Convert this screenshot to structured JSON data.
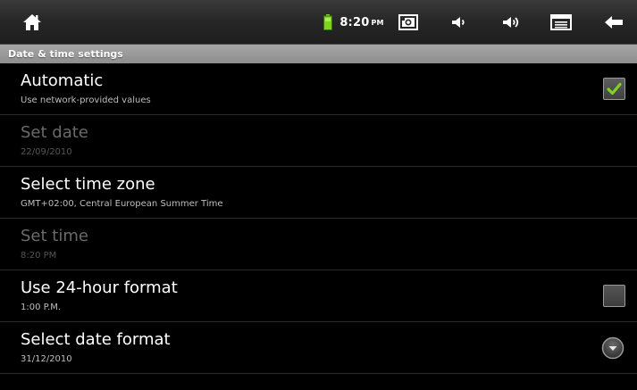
{
  "status_bar": {
    "time": "8:20",
    "ampm": "PM",
    "icons": [
      "home-icon",
      "battery-icon",
      "screenshot-icon",
      "volume-down-icon",
      "volume-up-icon",
      "menu-icon",
      "back-icon"
    ]
  },
  "title": "Date & time settings",
  "settings": [
    {
      "label": "Automatic",
      "summary": "Use network-provided values",
      "enabled": true,
      "widget": "checkbox",
      "checked": true
    },
    {
      "label": "Set date",
      "summary": "22/09/2010",
      "enabled": false
    },
    {
      "label": "Select time zone",
      "summary": "GMT+02:00, Central European Summer Time",
      "enabled": true
    },
    {
      "label": "Set time",
      "summary": "8:20 PM",
      "enabled": false
    },
    {
      "label": "Use 24-hour format",
      "summary": "1:00 P.M.",
      "enabled": true,
      "widget": "checkbox",
      "checked": false
    },
    {
      "label": "Select date format",
      "summary": "31/12/2010",
      "enabled": true,
      "widget": "dropdown"
    }
  ],
  "colors": {
    "check_mark": "#7ed321",
    "battery": "#7ed321"
  }
}
